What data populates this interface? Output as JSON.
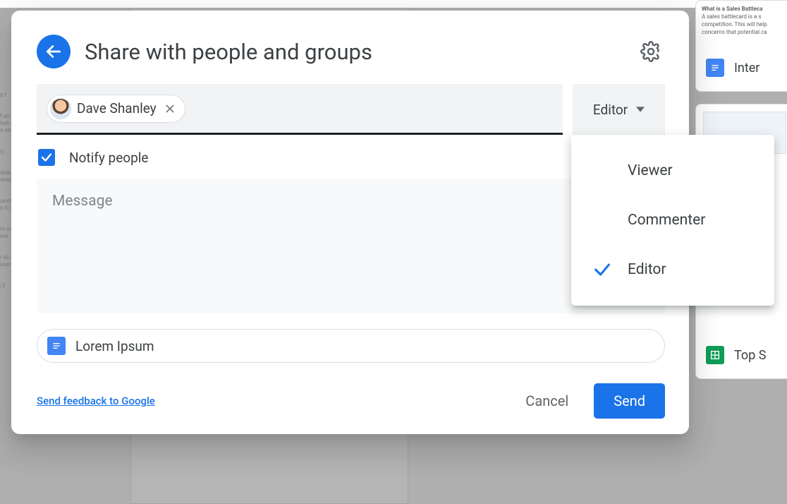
{
  "dialog": {
    "title": "Share with people and groups",
    "people_chip": {
      "name": "Dave Shanley"
    },
    "role_button": "Editor",
    "notify_label": "Notify people",
    "notify_checked": true,
    "message_placeholder": "Message",
    "attachment": "Lorem Ipsum",
    "feedback_link": "Send feedback to Google",
    "cancel": "Cancel",
    "send": "Send"
  },
  "role_dropdown": {
    "options": [
      {
        "label": "Viewer",
        "selected": false
      },
      {
        "label": "Commenter",
        "selected": false
      },
      {
        "label": "Editor",
        "selected": true
      }
    ]
  },
  "background": {
    "side_items": [
      {
        "label": "Inter",
        "icon": "docs"
      },
      {
        "label": "Top S",
        "icon": "sheets"
      }
    ]
  }
}
